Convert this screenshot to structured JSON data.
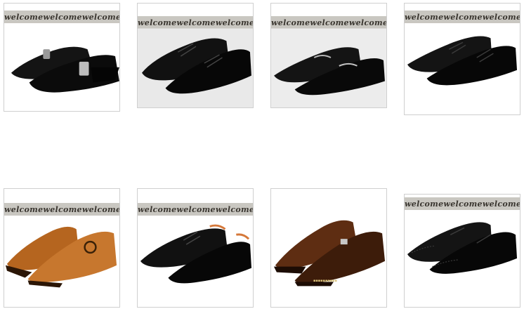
{
  "tiles": [
    {
      "banner": [
        "welcome",
        "welcome",
        "welcome"
      ],
      "shoe": "suede-buckle-loafer",
      "color": "#121212"
    },
    {
      "banner": [
        "welcome",
        "welcome",
        "welcome"
      ],
      "shoe": "lace-up-derby",
      "color": "#0e0e0e"
    },
    {
      "banner": [
        "welcome",
        "welcome",
        "welcome"
      ],
      "shoe": "horsebit-loafer",
      "color": "#111111"
    },
    {
      "banner": [
        "welcome",
        "welcome",
        "welcome"
      ],
      "shoe": "lace-up-oxford",
      "color": "#0f0f0f"
    },
    {
      "banner": [
        "welcome",
        "welcome",
        "welcome"
      ],
      "shoe": "ring-strap-monk",
      "color": "#b86a28"
    },
    {
      "banner": [
        "welcome",
        "welcome",
        "welcome"
      ],
      "shoe": "lace-up-derby",
      "color": "#0e0e0e"
    },
    {
      "banner": [],
      "shoe": "single-monk-strap",
      "color": "#5a2c14"
    },
    {
      "banner": [
        "welcome",
        "welcome",
        "welcome"
      ],
      "shoe": "wingtip-brogue",
      "color": "#0f0f0f"
    }
  ]
}
